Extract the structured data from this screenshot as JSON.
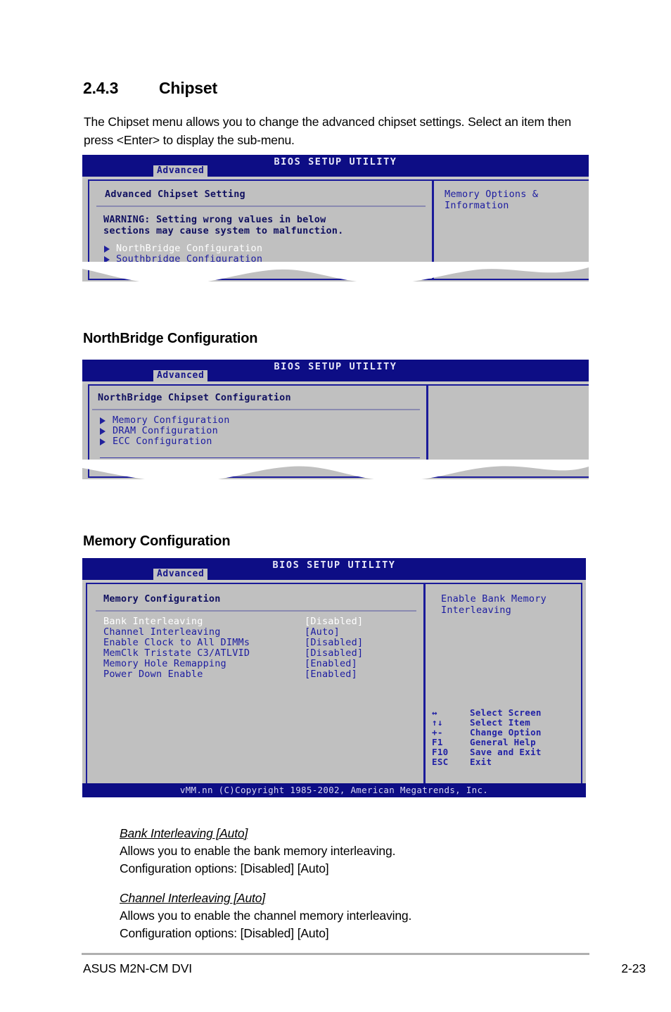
{
  "document": {
    "section_number": "2.4.3",
    "section_title": "Chipset",
    "intro_paragraph": "The Chipset menu allows you to change the advanced chipset settings. Select an item then press <Enter> to display the sub-menu.",
    "subheading_northbridge": "NorthBridge Configuration",
    "subheading_memory": "Memory Configuration",
    "footer_left": "ASUS M2N-CM DVI",
    "footer_right": "2-23"
  },
  "descriptions": [
    {
      "title": "Bank Interleaving [Auto]",
      "line1": "Allows you to enable the bank memory interleaving.",
      "line2": "Configuration options: [Disabled] [Auto]"
    },
    {
      "title": "Channel Interleaving [Auto]",
      "line1": "Allows you to enable the channel memory interleaving.",
      "line2": "Configuration options: [Disabled] [Auto]"
    }
  ],
  "bios_common": {
    "title": "BIOS SETUP UTILITY",
    "tab": "Advanced",
    "copyright": "vMM.nn (C)Copyright 1985-2002, American Megatrends, Inc."
  },
  "bios_chipset": {
    "panel_title": "Advanced Chipset Setting",
    "warning_line1": "WARNING: Setting wrong values in below",
    "warning_line2": "sections may cause system to malfunction.",
    "menu_items": [
      {
        "label": "NorthBridge Configuration",
        "selected": true
      },
      {
        "label": "Southbridge Configuration",
        "selected": false
      }
    ],
    "help_line1": "Memory Options &",
    "help_line2": "Information"
  },
  "bios_northbridge": {
    "panel_title": "NorthBridge Chipset Configuration",
    "menu_items": [
      {
        "label": "Memory Configuration",
        "selected": false
      },
      {
        "label": "DRAM Configuration",
        "selected": false
      },
      {
        "label": "ECC Configuration",
        "selected": false
      }
    ]
  },
  "bios_memory": {
    "panel_title": "Memory Configuration",
    "settings": [
      {
        "label": "Bank Interleaving",
        "value": "[Disabled]",
        "selected": true
      },
      {
        "label": "Channel Interleaving",
        "value": "[Auto]",
        "selected": false
      },
      {
        "label": "Enable Clock to All DIMMs",
        "value": "[Disabled]",
        "selected": false
      },
      {
        "label": "MemClk Tristate C3/ATLVID",
        "value": "[Disabled]",
        "selected": false
      },
      {
        "label": "Memory Hole Remapping",
        "value": "[Enabled]",
        "selected": false
      },
      {
        "label": "Power Down Enable",
        "value": "[Enabled]",
        "selected": false
      }
    ],
    "help_line1": "Enable Bank Memory",
    "help_line2": "Interleaving",
    "nav_keys": [
      {
        "key": "↔",
        "action": "Select Screen"
      },
      {
        "key": "↑↓",
        "action": "Select Item"
      },
      {
        "key": "+-",
        "action": "Change Option"
      },
      {
        "key": "F1",
        "action": "General Help"
      },
      {
        "key": "F10",
        "action": "Save and Exit"
      },
      {
        "key": "ESC",
        "action": "Exit"
      }
    ]
  },
  "colors": {
    "bios_navy": "#0d0d85",
    "bios_grey": "#c0c0c0",
    "bios_blue_text": "#1c1ca0",
    "bios_selected_text": "#ffffff"
  }
}
